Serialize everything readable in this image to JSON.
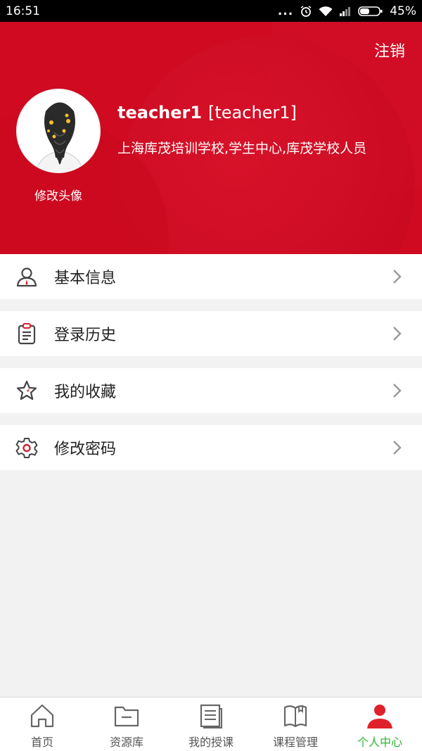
{
  "status_bar": {
    "time": "16:51",
    "signal_dots": "...",
    "battery": "45%"
  },
  "header": {
    "logout_label": "注销",
    "edit_avatar_label": "修改头像",
    "username": "teacher1",
    "account": "[teacher1]",
    "org": "上海库茂培训学校,学生中心,库茂学校人员"
  },
  "menu": {
    "items": [
      {
        "label": "基本信息",
        "icon": "user-icon"
      },
      {
        "label": "登录历史",
        "icon": "clipboard-icon"
      },
      {
        "label": "我的收藏",
        "icon": "star-icon"
      },
      {
        "label": "修改密码",
        "icon": "gear-icon"
      }
    ]
  },
  "bottom_nav": {
    "items": [
      {
        "label": "首页",
        "icon": "home-icon"
      },
      {
        "label": "资源库",
        "icon": "folder-icon"
      },
      {
        "label": "我的授课",
        "icon": "document-icon"
      },
      {
        "label": "课程管理",
        "icon": "book-icon"
      },
      {
        "label": "个人中心",
        "icon": "person-icon",
        "active": true
      }
    ]
  },
  "colors": {
    "accent": "#cf0a21",
    "active_tab": "#2db52d"
  }
}
